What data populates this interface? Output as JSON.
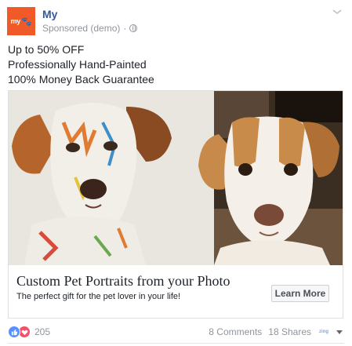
{
  "header": {
    "avatar_text": "my",
    "page_name": "My",
    "sponsored_label": "Sponsored (demo)",
    "separator": "·",
    "privacy_icon": "globe-icon",
    "menu_icon": "chevron-down-icon"
  },
  "post": {
    "lines": [
      "Up to 50% OFF",
      "Professionally Hand-Painted",
      "100% Money Back Guarantee"
    ]
  },
  "ad": {
    "image_alt": "Painted portrait of a dog next to the real dog",
    "headline": "Custom Pet Portraits from your Photo",
    "description": "The perfect gift for the pet lover in your life!",
    "cta_label": "Learn More"
  },
  "footer": {
    "reaction_icons": [
      "like-icon",
      "love-icon"
    ],
    "reaction_count": "205",
    "comments": "8 Comments",
    "shares": "18 Shares",
    "audience_icon": "page-avatar-icon",
    "audience_text": "zing",
    "dropdown_icon": "caret-down-icon"
  },
  "colors": {
    "brand": "#f05a28",
    "link": "#365899",
    "meta": "#90949c",
    "like": "#5890ff",
    "love": "#f25268"
  }
}
